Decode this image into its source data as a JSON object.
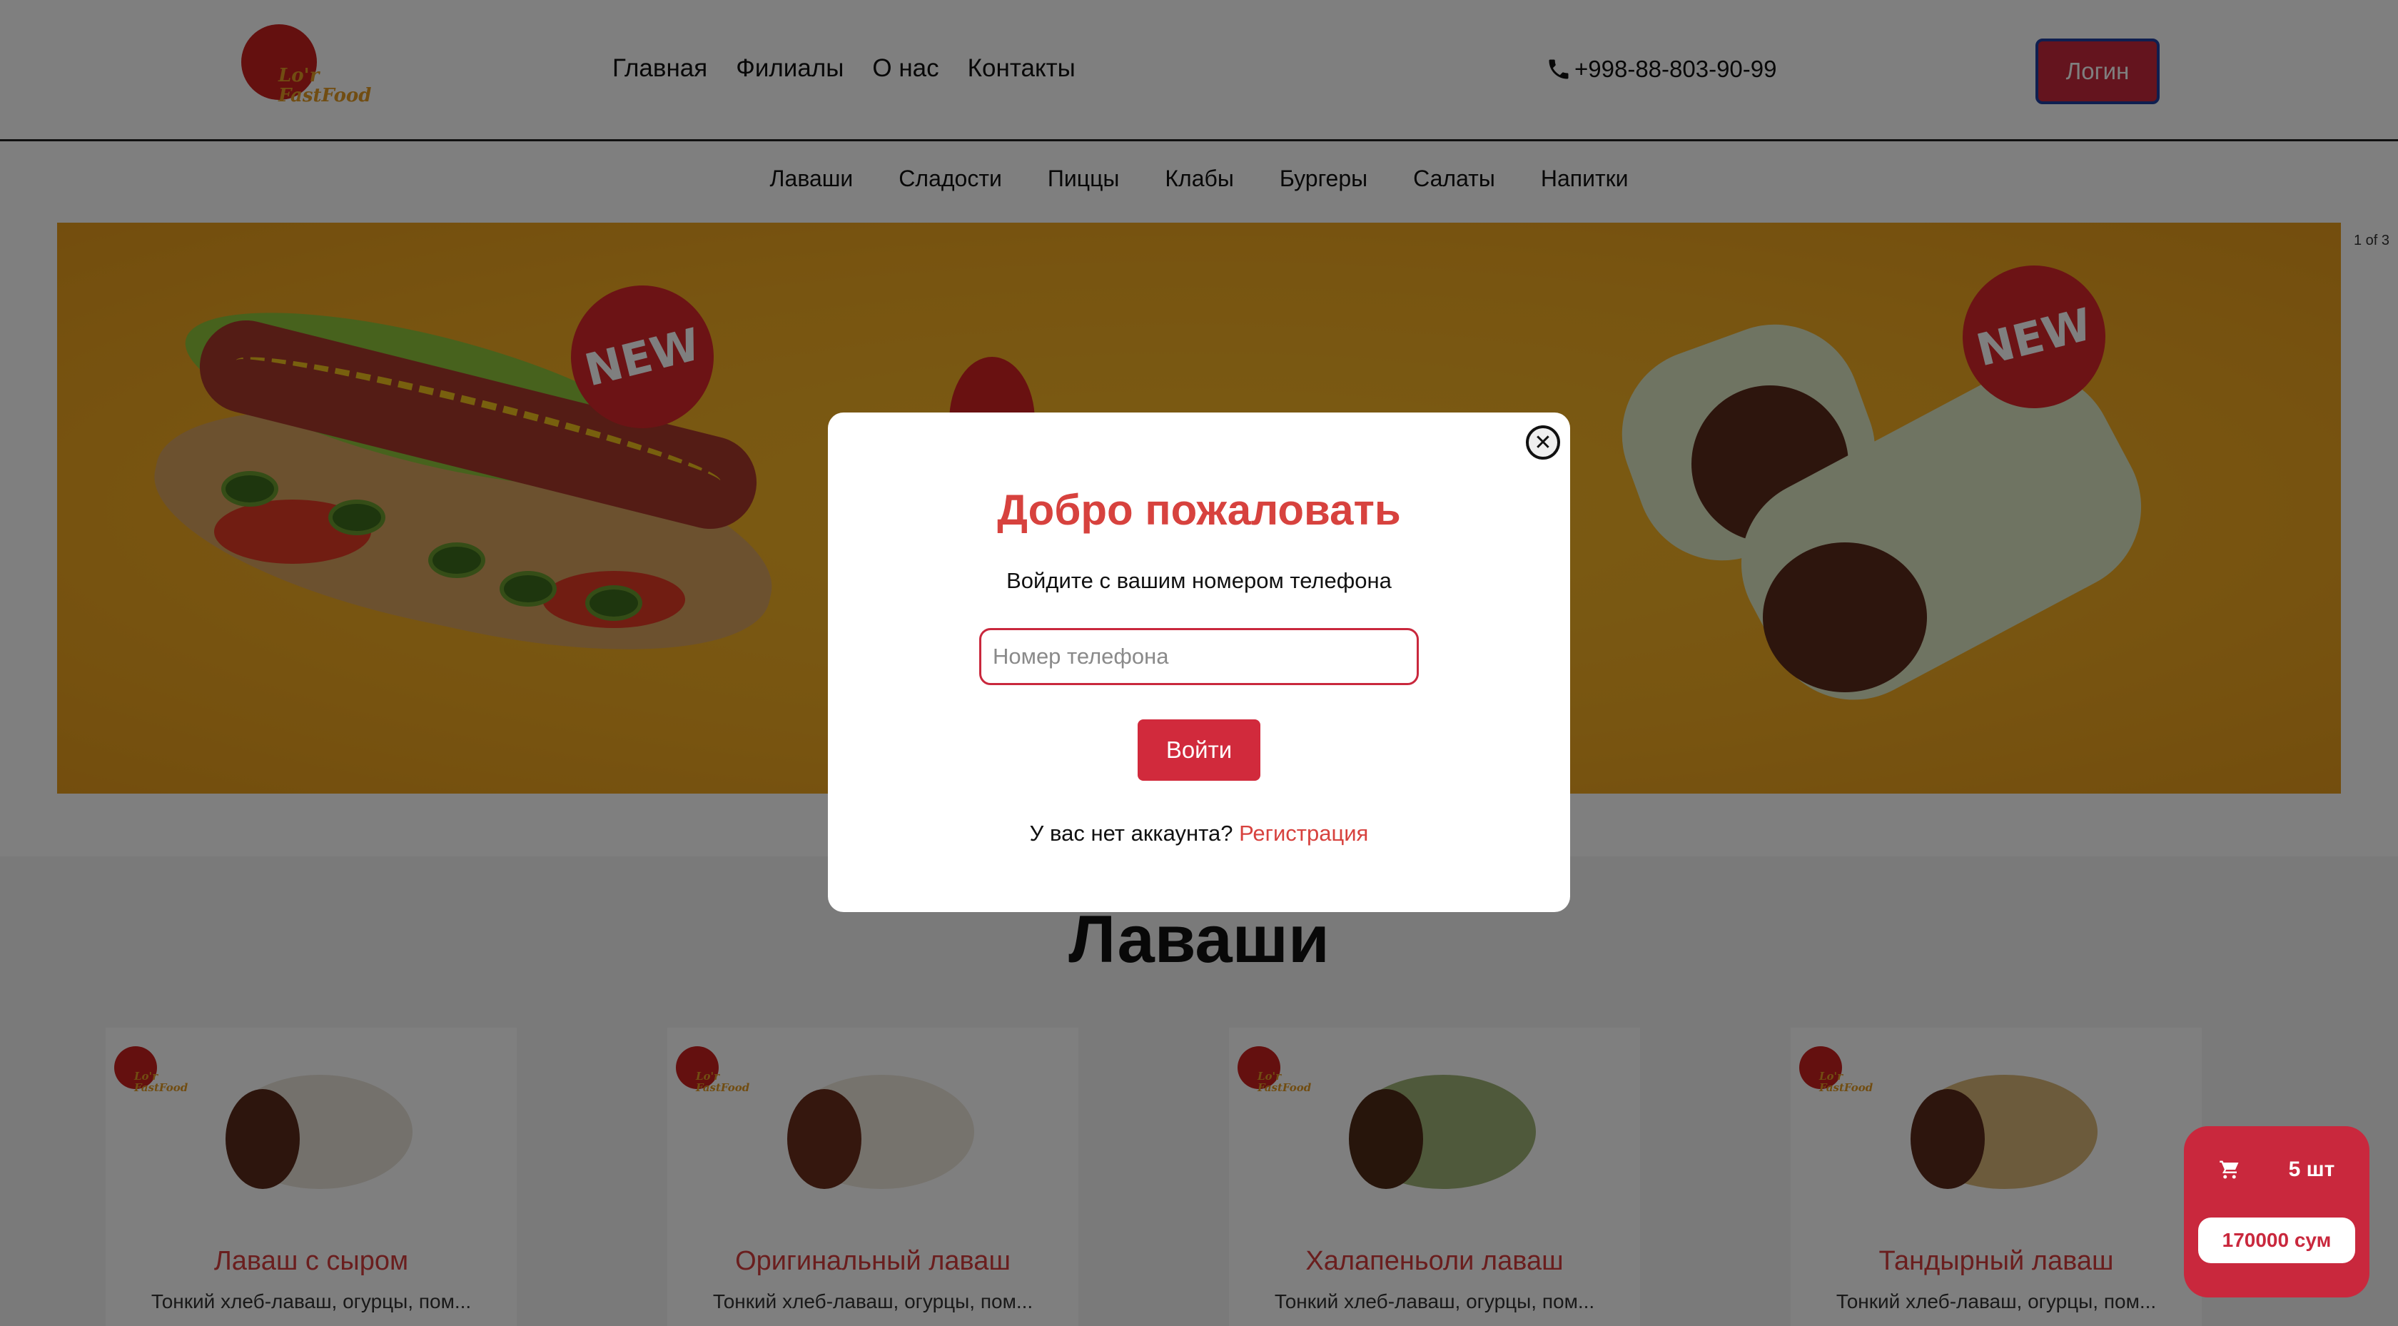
{
  "header": {
    "logo_text_line1": "Lo'r",
    "logo_text_line2": "FastFood",
    "nav": [
      "Главная",
      "Филиалы",
      "О нас",
      "Контакты"
    ],
    "phone": "+998-88-803-90-99",
    "login_label": "Логин"
  },
  "categories": [
    "Лаваши",
    "Сладости",
    "Пиццы",
    "Клабы",
    "Бургеры",
    "Салаты",
    "Напитки"
  ],
  "banner": {
    "badge_left": "NEW",
    "badge_right": "NEW",
    "slide_counter": "1 of 3"
  },
  "section": {
    "title": "Лаваши",
    "cards": [
      {
        "name": "Лаваш с сыром",
        "desc": "Тонкий хлеб-лаваш, огурцы, пом...",
        "wrap_color": "#e8e3d8"
      },
      {
        "name": "Оригинальный лаваш",
        "desc": "Тонкий хлеб-лаваш, огурцы, пом...",
        "wrap_color": "#ede6da"
      },
      {
        "name": "Халапеньоли лаваш",
        "desc": "Тонкий хлеб-лаваш, огурцы, пом...",
        "wrap_color": "#9fb377"
      },
      {
        "name": "Тандырный лаваш",
        "desc": "Тонкий хлеб-лаваш, огурцы, пом...",
        "wrap_color": "#d9b779"
      }
    ]
  },
  "cart": {
    "count": "5 шт",
    "total": "170000 сум"
  },
  "modal": {
    "title": "Добро пожаловать",
    "subtitle": "Войдите с вашим номером телефона",
    "phone_placeholder": "Номер телефона",
    "phone_value": "",
    "submit_label": "Войти",
    "signup_prompt": "У вас нет аккаунта?",
    "signup_link": "Регистрация"
  },
  "colors": {
    "brand_red": "#c9283d",
    "title_red": "#d7423e",
    "banner_yellow": "#f1aa22"
  }
}
